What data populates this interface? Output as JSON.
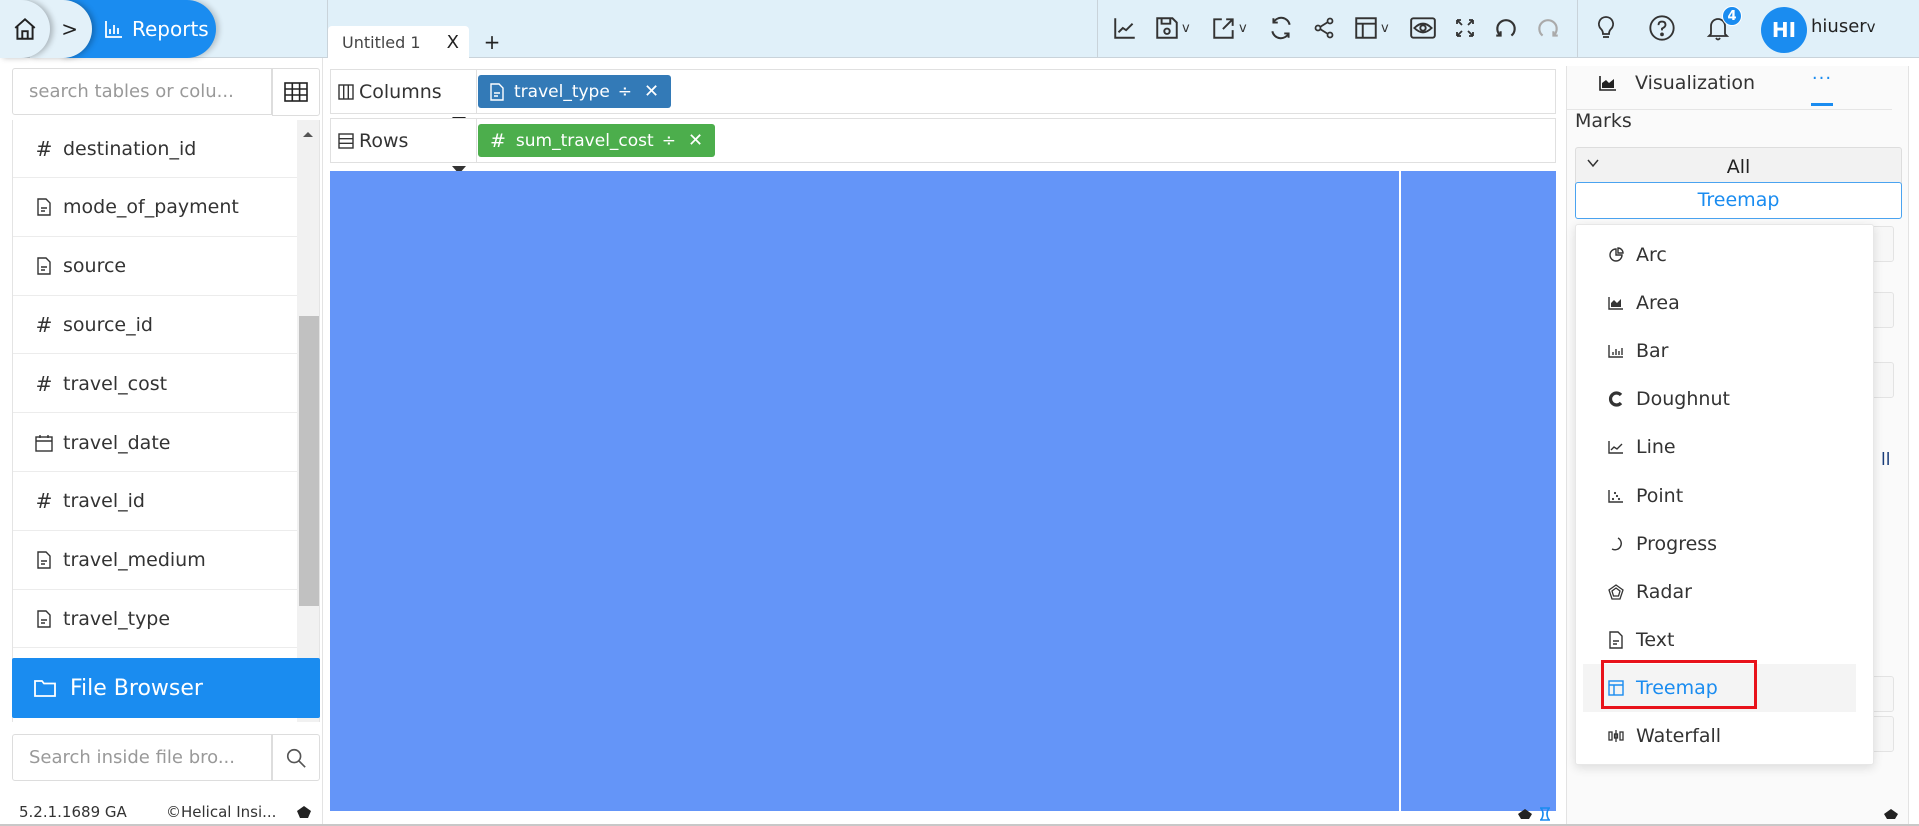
{
  "breadcrumb": {
    "home_icon": "home-icon",
    "separator": ">",
    "current": "Reports",
    "current_icon": "bar-chart-icon"
  },
  "tabs": {
    "items": [
      {
        "label": "Untitled 1",
        "close": "X"
      }
    ],
    "add": "+"
  },
  "toolbar": {
    "icons": [
      "line-chart-icon",
      "save-icon",
      "export-icon",
      "refresh-icon",
      "share-icon",
      "layout-icon",
      "preview-icon",
      "fullscreen-icon",
      "undo-icon",
      "redo-icon"
    ],
    "caret": "v",
    "help": [
      "lightbulb-icon",
      "help-icon",
      "notification-bell-icon"
    ],
    "notification_count": "4",
    "avatar_initials": "HI",
    "username": "hiuser",
    "user_caret": "v"
  },
  "sidebar": {
    "search_placeholder": "search tables or colu...",
    "fields": [
      {
        "type": "number",
        "name": "destination_id"
      },
      {
        "type": "text",
        "name": "mode_of_payment"
      },
      {
        "type": "text",
        "name": "source"
      },
      {
        "type": "number",
        "name": "source_id"
      },
      {
        "type": "number",
        "name": "travel_cost"
      },
      {
        "type": "date",
        "name": "travel_date"
      },
      {
        "type": "number",
        "name": "travel_id"
      },
      {
        "type": "text",
        "name": "travel_medium"
      },
      {
        "type": "text",
        "name": "travel_type"
      }
    ],
    "file_browser_label": "File Browser",
    "file_search_placeholder": "Search inside file bro...",
    "version": "5.2.1.1689 GA",
    "copyright": "©Helical Insi..."
  },
  "shelves": {
    "columns": {
      "label": "Columns",
      "pill": {
        "type": "text",
        "name": "travel_type",
        "sort": "÷",
        "remove": "✕"
      }
    },
    "rows": {
      "label": "Rows",
      "pill": {
        "type": "number",
        "name": "sum_travel_cost",
        "sort": "÷",
        "remove": "✕"
      }
    }
  },
  "canvas": {
    "chart_type": "treemap",
    "color": "#6495f8",
    "segments": 2
  },
  "right_panel": {
    "tab_label": "Visualization",
    "more_label": "···",
    "marks_label": "Marks",
    "marks_value": "All",
    "chart_type_value": "Treemap",
    "hidden_text": "ll"
  },
  "chart_dropdown": {
    "items": [
      {
        "label": "Arc",
        "icon": "arc-chart-icon"
      },
      {
        "label": "Area",
        "icon": "area-chart-icon"
      },
      {
        "label": "Bar",
        "icon": "bar-chart-icon"
      },
      {
        "label": "Doughnut",
        "icon": "doughnut-chart-icon"
      },
      {
        "label": "Line",
        "icon": "line-chart-icon"
      },
      {
        "label": "Point",
        "icon": "point-chart-icon"
      },
      {
        "label": "Progress",
        "icon": "progress-chart-icon"
      },
      {
        "label": "Radar",
        "icon": "radar-chart-icon"
      },
      {
        "label": "Text",
        "icon": "text-chart-icon"
      },
      {
        "label": "Treemap",
        "icon": "treemap-chart-icon",
        "selected": true
      },
      {
        "label": "Waterfall",
        "icon": "waterfall-chart-icon"
      }
    ],
    "highlight_color": "#e8131b"
  },
  "colors": {
    "accent": "#1a8cf0",
    "columns_pill": "#337ab7",
    "rows_pill": "#4cae4c",
    "topbar": "#e0f0f9"
  }
}
